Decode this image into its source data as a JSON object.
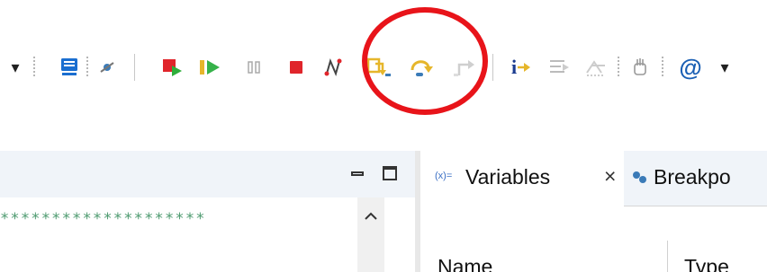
{
  "toolbar": {
    "items": [
      {
        "name": "view-menu-dropdown-icon",
        "glyph": "▾"
      },
      {
        "name": "display-icon",
        "glyph": ""
      },
      {
        "name": "skip-breakpoints-icon",
        "glyph": ""
      },
      {
        "name": "relaunch-icon",
        "glyph": ""
      },
      {
        "name": "resume-icon",
        "glyph": ""
      },
      {
        "name": "suspend-icon",
        "glyph": ""
      },
      {
        "name": "terminate-icon",
        "glyph": ""
      },
      {
        "name": "disconnect-icon",
        "glyph": ""
      },
      {
        "name": "step-into-icon",
        "glyph": ""
      },
      {
        "name": "step-over-icon",
        "glyph": ""
      },
      {
        "name": "step-return-icon",
        "glyph": ""
      },
      {
        "name": "instruction-stepping-icon",
        "glyph": ""
      },
      {
        "name": "use-step-filters-icon",
        "glyph": ""
      },
      {
        "name": "drop-to-frame-icon",
        "glyph": ""
      },
      {
        "name": "hand-tool-icon",
        "glyph": ""
      },
      {
        "name": "at-sign-icon",
        "glyph": "@"
      },
      {
        "name": "more-dropdown-icon",
        "glyph": "▾"
      }
    ],
    "instruction_label": "i"
  },
  "editor": {
    "code_line": "********************",
    "minimize_glyph": "▭",
    "maximize_glyph": "□",
    "scroll_up_glyph": "^"
  },
  "variables_tab": {
    "icon_text": "(x)=",
    "label": "Variables",
    "close_glyph": "×"
  },
  "breakpoints_tab": {
    "label": "Breakpo"
  },
  "table": {
    "columns": [
      "Name",
      "Type"
    ]
  },
  "colors": {
    "annotation": "#e8141a",
    "editor_header_bg": "#f0f4f9",
    "code_text": "#4d9a6f"
  }
}
